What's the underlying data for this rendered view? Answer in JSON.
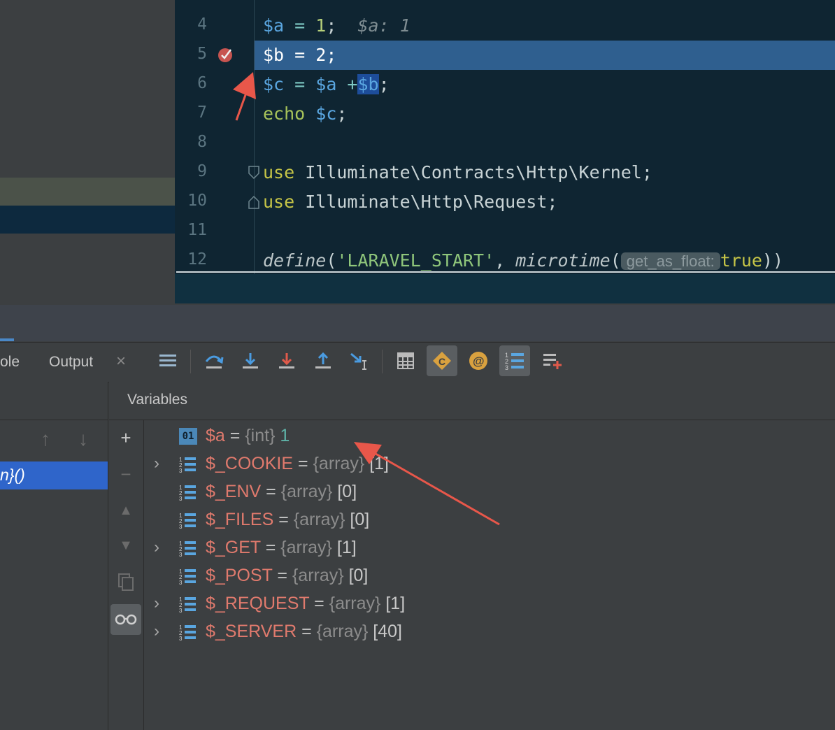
{
  "editor": {
    "line_numbers": [
      "4",
      "5",
      "6",
      "7",
      "8",
      "9",
      "10",
      "11",
      "12"
    ],
    "lines": {
      "l4": {
        "var_a": "$a",
        "eq": " = ",
        "num": "1",
        "semi": ";",
        "inline": "  $a: 1"
      },
      "l5": {
        "var_b": "$b",
        "eq": " = ",
        "num": "2",
        "semi": ";"
      },
      "l6": {
        "var_c": "$c",
        "eq": " = ",
        "var_a": "$a",
        "plus": " +",
        "var_b": "$b",
        "semi": ";"
      },
      "l7": {
        "kw": "echo",
        "sp": " ",
        "var_c": "$c",
        "semi": ";"
      },
      "l9": {
        "kw": "use",
        "rest": " Illuminate\\Contracts\\Http\\Kernel;"
      },
      "l10": {
        "kw": "use",
        "rest": " Illuminate\\Http\\Request;"
      },
      "l12": {
        "fn": "define",
        "p1": "(",
        "str": "'LARAVEL_START'",
        "comma": ", ",
        "fn2": "microtime",
        "p2": "(",
        "hint": "get_as_float:",
        "kw": "true",
        "p3": "))"
      }
    }
  },
  "debug": {
    "tabs": {
      "console_partial": "ole",
      "output": "Output",
      "close": "×"
    },
    "variables_title": "Variables",
    "variables": [
      {
        "name": "$a",
        "eq": " = ",
        "type": "{int}",
        "value": "1",
        "icon": "01",
        "expandable": false
      },
      {
        "name": "$_COOKIE",
        "eq": " = ",
        "type": "{array}",
        "value": "[1]",
        "icon": "array",
        "expandable": true
      },
      {
        "name": "$_ENV",
        "eq": " = ",
        "type": "{array}",
        "value": "[0]",
        "icon": "array",
        "expandable": false
      },
      {
        "name": "$_FILES",
        "eq": " = ",
        "type": "{array}",
        "value": "[0]",
        "icon": "array",
        "expandable": false
      },
      {
        "name": "$_GET",
        "eq": " = ",
        "type": "{array}",
        "value": "[1]",
        "icon": "array",
        "expandable": true
      },
      {
        "name": "$_POST",
        "eq": " = ",
        "type": "{array}",
        "value": "[0]",
        "icon": "array",
        "expandable": false
      },
      {
        "name": "$_REQUEST",
        "eq": " = ",
        "type": "{array}",
        "value": "[1]",
        "icon": "array",
        "expandable": true
      },
      {
        "name": "$_SERVER",
        "eq": " = ",
        "type": "{array}",
        "value": "[40]",
        "icon": "array",
        "expandable": true
      }
    ],
    "frame_selected": "n}()"
  },
  "colors": {
    "annotation_arrow": "#e8574a",
    "exec_line": "#2f5f8f",
    "breakpoint": "#c75450"
  }
}
